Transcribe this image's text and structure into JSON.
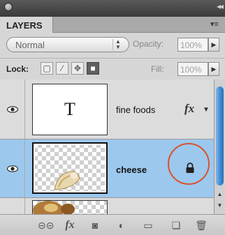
{
  "panel": {
    "tab_label": "LAYERS"
  },
  "controls": {
    "blend_mode": "Normal",
    "opacity_label": "Opacity:",
    "opacity_value": "100%",
    "lock_label": "Lock:",
    "fill_label": "Fill:",
    "fill_value": "100%"
  },
  "layers": [
    {
      "name": "fine foods",
      "thumb_text": "T",
      "fx": "fx",
      "selected": false
    },
    {
      "name": "cheese",
      "selected": true,
      "locked": true
    },
    {
      "name": "",
      "selected": false
    }
  ],
  "bottom_icons": [
    "link-icon",
    "fx-icon",
    "mask-icon",
    "adjustment-icon",
    "folder-icon",
    "new-layer-icon",
    "trash-icon"
  ],
  "colors": {
    "selected_row": "#9cc8ee",
    "highlight_circle": "#d9532b",
    "scroll_thumb": "#3c88d4"
  }
}
